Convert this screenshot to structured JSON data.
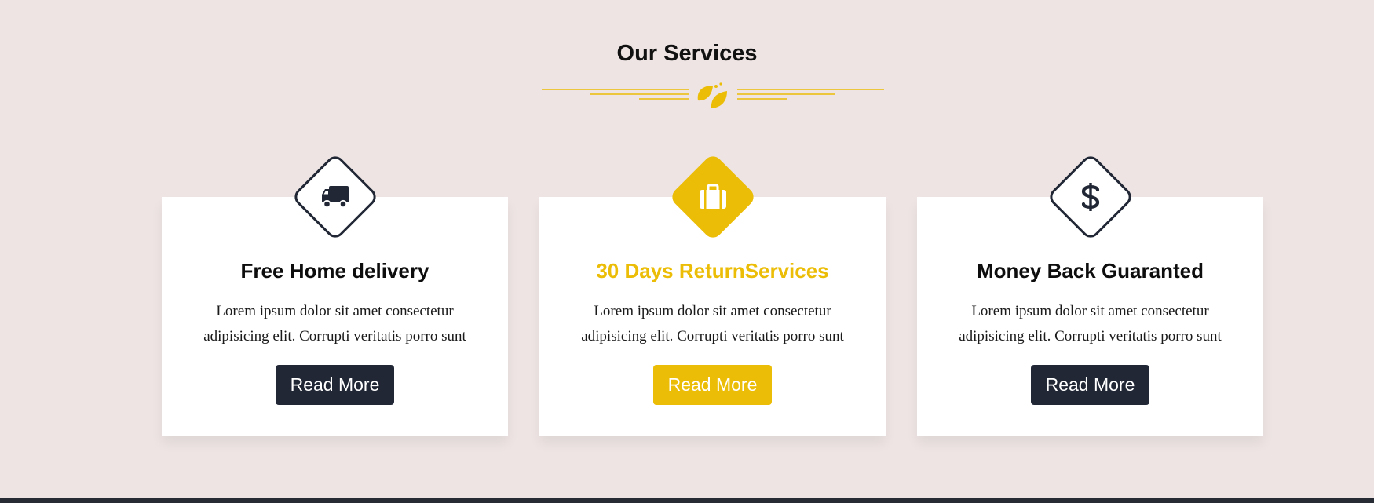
{
  "section": {
    "title": "Our Services"
  },
  "colors": {
    "accent": "#ecbd07",
    "dark": "#212735",
    "background": "#ede4e3",
    "card": "#ffffff"
  },
  "services": [
    {
      "icon": "truck-icon",
      "title": "Free Home delivery",
      "text": "Lorem ipsum dolor sit amet consectetur adipisicing elit. Corrupti veritatis porro sunt",
      "button": "Read More",
      "active": false
    },
    {
      "icon": "briefcase-icon",
      "title": "30 Days ReturnServices",
      "text": "Lorem ipsum dolor sit amet consectetur adipisicing elit. Corrupti veritatis porro sunt",
      "button": "Read More",
      "active": true
    },
    {
      "icon": "dollar-icon",
      "title": "Money Back Guaranted",
      "text": "Lorem ipsum dolor sit amet consectetur adipisicing elit. Corrupti veritatis porro sunt",
      "button": "Read More",
      "active": false
    }
  ]
}
